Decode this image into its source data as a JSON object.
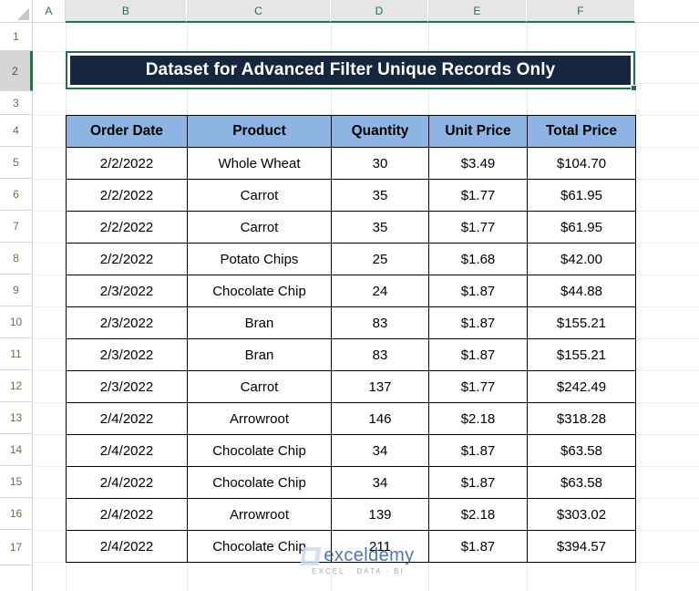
{
  "app": {
    "type": "spreadsheet",
    "accent_green": "#217346",
    "header_fill": "#8eb4e3",
    "title_fill": "#16263f"
  },
  "column_headers": [
    "A",
    "B",
    "C",
    "D",
    "E",
    "F"
  ],
  "row_headers": [
    "1",
    "2",
    "3",
    "4",
    "5",
    "6",
    "7",
    "8",
    "9",
    "10",
    "11",
    "12",
    "13",
    "14",
    "15",
    "16",
    "17"
  ],
  "active_row": "2",
  "title": {
    "text": "Dataset for Advanced Filter Unique Records Only"
  },
  "table": {
    "headers": [
      "Order Date",
      "Product",
      "Quantity",
      "Unit Price",
      "Total Price"
    ],
    "rows": [
      [
        "2/2/2022",
        "Whole Wheat",
        "30",
        "$3.49",
        "$104.70"
      ],
      [
        "2/2/2022",
        "Carrot",
        "35",
        "$1.77",
        "$61.95"
      ],
      [
        "2/2/2022",
        "Carrot",
        "35",
        "$1.77",
        "$61.95"
      ],
      [
        "2/2/2022",
        "Potato Chips",
        "25",
        "$1.68",
        "$42.00"
      ],
      [
        "2/3/2022",
        "Chocolate Chip",
        "24",
        "$1.87",
        "$44.88"
      ],
      [
        "2/3/2022",
        "Bran",
        "83",
        "$1.87",
        "$155.21"
      ],
      [
        "2/3/2022",
        "Bran",
        "83",
        "$1.87",
        "$155.21"
      ],
      [
        "2/3/2022",
        "Carrot",
        "137",
        "$1.77",
        "$242.49"
      ],
      [
        "2/4/2022",
        "Arrowroot",
        "146",
        "$2.18",
        "$318.28"
      ],
      [
        "2/4/2022",
        "Chocolate Chip",
        "34",
        "$1.87",
        "$63.58"
      ],
      [
        "2/4/2022",
        "Chocolate Chip",
        "34",
        "$1.87",
        "$63.58"
      ],
      [
        "2/4/2022",
        "Arrowroot",
        "139",
        "$2.18",
        "$303.02"
      ],
      [
        "2/4/2022",
        "Chocolate Chip",
        "211",
        "$1.87",
        "$394.57"
      ]
    ]
  },
  "watermark": {
    "name": "exceldemy",
    "tagline": "EXCEL · DATA · BI"
  }
}
